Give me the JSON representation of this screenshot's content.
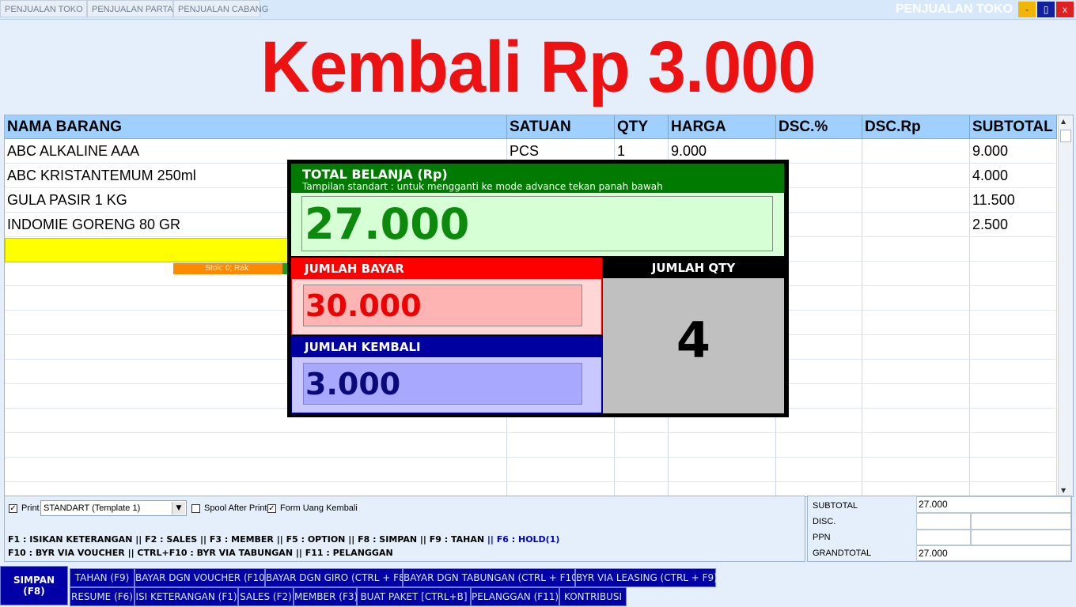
{
  "tabs": [
    "PENJUALAN TOKO",
    "PENJUALAN PARTAI",
    "PENJUALAN CABANG"
  ],
  "window": {
    "title": "PENJUALAN TOKO",
    "minimize": "-",
    "maximize": "▯",
    "close": "x"
  },
  "banner": "Kembali Rp 3.000",
  "table": {
    "headers": [
      "NAMA BARANG",
      "SATUAN",
      "QTY",
      "HARGA",
      "DSC.%",
      "DSC.Rp",
      "SUBTOTAL"
    ],
    "rows": [
      [
        "ABC ALKALINE AAA",
        "PCS",
        "1",
        "9.000",
        "",
        "",
        "9.000"
      ],
      [
        "ABC KRISTANTEMUM 250ml",
        "",
        "",
        "",
        "",
        "",
        "4.000"
      ],
      [
        "GULA PASIR 1 KG",
        "",
        "",
        "",
        "",
        "",
        "11.500"
      ],
      [
        "INDOMIE GORENG 80 GR",
        "",
        "",
        "",
        "",
        "",
        "2.500"
      ]
    ],
    "stock_info": "Stok: 0; Rak:"
  },
  "popup": {
    "total_label": "TOTAL BELANJA (Rp)",
    "total_hint": "Tampilan standart : untuk mengganti ke mode advance tekan panah bawah",
    "total_value": "27.000",
    "bayar_label": "JUMLAH BAYAR",
    "bayar_value": "30.000",
    "kembali_label": "JUMLAH KEMBALI",
    "kembali_value": "3.000",
    "qty_label": "JUMLAH QTY",
    "qty_value": "4"
  },
  "options": {
    "print_label": "Print",
    "print_checked": true,
    "template_value": "STANDART (Template 1)",
    "spool_label": "Spool After Print",
    "spool_checked": false,
    "form_label": "Form Uang Kembali",
    "form_checked": true
  },
  "shortcuts": {
    "line1": "F1 : ISIKAN KETERANGAN || F2 : SALES || F3 : MEMBER || F5 : OPTION  || F8 : SIMPAN || F9 : TAHAN ",
    "line1_hold": "|| F6 : HOLD(1)",
    "line2": "F10 : BYR VIA VOUCHER || CTRL+F10 : BYR VIA TABUNGAN  || F11 : PELANGGAN"
  },
  "totals": {
    "subtotal_label": "SUBTOTAL",
    "subtotal_value": "27.000",
    "disc_label": "DISC.",
    "ppn_label": "PPN",
    "grandtotal_label": "GRANDTOTAL",
    "grandtotal_value": "27.000"
  },
  "buttons": {
    "simpan": "SIMPAN\n(F8)",
    "row1": [
      "TAHAN (F9)",
      "BAYAR DGN VOUCHER (F10)",
      "BAYAR DGN GIRO (CTRL + F8)",
      "BAYAR DGN TABUNGAN (CTRL + F10)",
      "BYR VIA LEASING (CTRL + F9)"
    ],
    "row2": [
      "RESUME (F6)",
      "ISI KETERANGAN (F1)",
      "SALES (F2)",
      "MEMBER (F3)",
      "BUAT PAKET [CTRL+B]",
      "PELANGGAN (F11)",
      "KONTRIBUSI"
    ]
  },
  "colors": {
    "banner": "#ee1111",
    "header": "#9fd0ff",
    "selected_row": "#ffff00",
    "total_green": "#007a00",
    "bayar_red": "#ff0000",
    "kembali_blue": "#0000a0",
    "button_blue": "#0000a6"
  }
}
